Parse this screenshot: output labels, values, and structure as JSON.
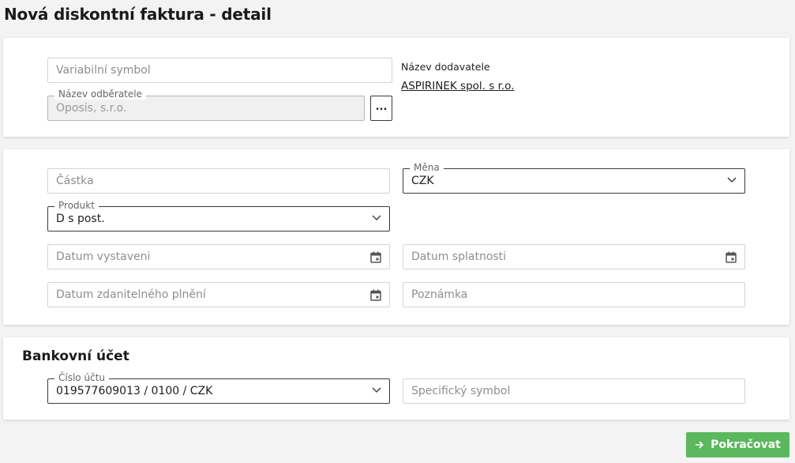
{
  "page": {
    "title": "Nová diskontní faktura - detail"
  },
  "parties": {
    "variable_symbol": {
      "placeholder": "Variabilní symbol"
    },
    "customer": {
      "label": "Název odběratele",
      "value": "Oposis, s.r.o.",
      "picker_label": "..."
    },
    "supplier": {
      "label": "Název dodavatele",
      "value": "ASPIRINEK spol. s r.o."
    }
  },
  "invoice": {
    "amount": {
      "placeholder": "Částka"
    },
    "currency": {
      "label": "Měna",
      "value": "CZK"
    },
    "product": {
      "label": "Produkt",
      "value": "D s post."
    },
    "issue_date": {
      "placeholder": "Datum vystaveni"
    },
    "due_date": {
      "placeholder": "Datum splatnosti"
    },
    "taxable_date": {
      "placeholder": "Datum zdanitelného plnění"
    },
    "note": {
      "placeholder": "Poznámka"
    }
  },
  "bank": {
    "title": "Bankovní účet",
    "account": {
      "label": "Číslo účtu",
      "value": "019577609013 / 0100 / CZK"
    },
    "specific_symbol": {
      "placeholder": "Specifický symbol"
    }
  },
  "actions": {
    "continue_label": "Pokračovat"
  },
  "colors": {
    "primary_button": "#5cb85c",
    "field_border": "#d4d4d4",
    "background": "#f3f3f4"
  },
  "icons": [
    "chevron-down-icon",
    "calendar-icon",
    "arrow-right-icon"
  ]
}
